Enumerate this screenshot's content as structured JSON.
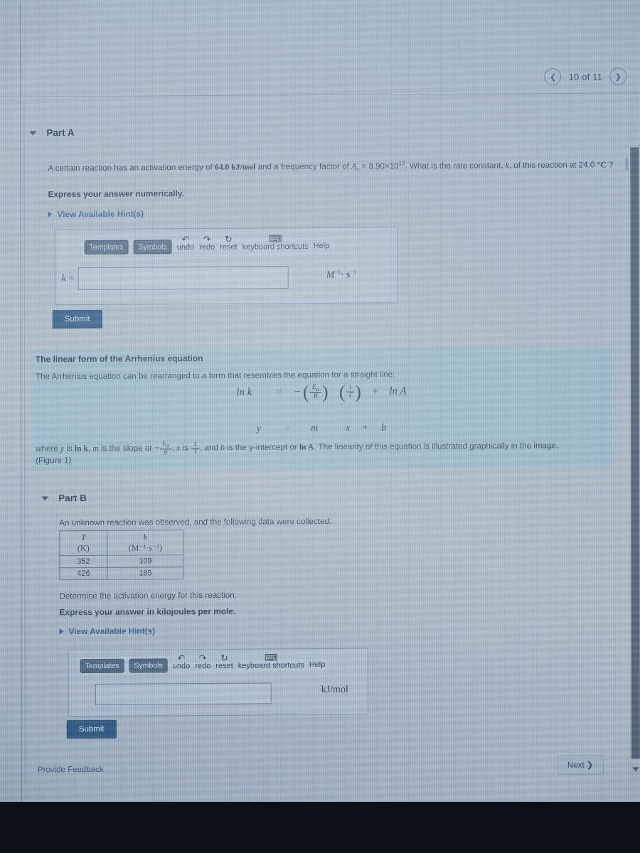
{
  "pager": {
    "prev_icon": "chevron-left-icon",
    "label": "10 of 11",
    "next_icon": "chevron-right-icon"
  },
  "partA": {
    "title": "Part A",
    "question_line1_pre": "A certain reaction has an activation energy of ",
    "activation_energy": "64.0",
    "energy_units": "kJ/mol",
    "question_line1_mid": " and a frequency factor of ",
    "frequency_symbol": "A",
    "frequency_subscript": "1",
    "frequency_value": "8.90×10",
    "frequency_exponent": "12",
    "question_line1_post": ". What is the rate constant, ",
    "rate_symbol": "k",
    "question_line1_end": ", of this reaction at ",
    "temperature": "24.0",
    "temperature_units": "°C",
    "question_mark": "?",
    "instruction": "Express your answer numerically.",
    "hint_label": "View Available Hint(s)",
    "answer_prefix": "k =",
    "answer_value": "",
    "answer_units_num": "M",
    "answer_units_sup1": "−1",
    "answer_units_sup2": "−1",
    "answer_units_mid": "· s",
    "submit_label": "Submit"
  },
  "toolbar": {
    "templates_label": "Templates",
    "symbols_label": "Symbols",
    "undo_label": "undo",
    "undo_icon": "undo-arrow-icon",
    "redo_label": "redo",
    "redo_icon": "redo-arrow-icon",
    "reset_label": "reset",
    "reset_icon": "reset-icon",
    "shortcuts_label": "keyboard shortcuts",
    "shortcuts_icon": "keyboard-icon",
    "help_label": "Help",
    "help_icon": "help-icon"
  },
  "info_panel": {
    "title": "The linear form of the Arrhenius equation",
    "intro": "The Arrhenius equation can be rearranged to a form that resembles the equation for a straight line:",
    "equation": {
      "lhs": "ln k",
      "equals": "=",
      "minus": "−",
      "frac1_num": "E",
      "frac1_sub": "a",
      "frac1_den": "R",
      "frac2_num": "1",
      "frac2_den": "T",
      "plus": "+",
      "rhs": "ln A"
    },
    "template_row": {
      "y": "y",
      "equals": "=",
      "m": "m",
      "x": "x",
      "plus": "+",
      "b": "b"
    },
    "where_pre": "where ",
    "where_y": "y",
    "where_1": " is ",
    "where_lnk": "ln k",
    "where_2": ", ",
    "where_m": "m",
    "where_3": " is the slope or ",
    "where_slope_num": "E",
    "where_slope_sub": "a",
    "where_slope_den": "R",
    "where_4": ", ",
    "where_x": "x",
    "where_5": " is ",
    "where_x_num": "1",
    "where_x_den": "T",
    "where_6": ", and ",
    "where_b": "b",
    "where_7": " is the y-intercept or ",
    "where_lnA": "ln A",
    "where_8": ". The linearity of this equation is illustrated graphically in the image.",
    "figure_ref": "(Figure 1)"
  },
  "partB": {
    "title": "Part B",
    "intro": "An unknown reaction was observed, and the following data were collected:",
    "table": {
      "headers": [
        {
          "symbol": "T",
          "units": "(K)"
        },
        {
          "symbol": "k",
          "units": "(M⁻¹·s⁻¹)"
        }
      ],
      "rows": [
        {
          "T": "352",
          "k": "109"
        },
        {
          "T": "426",
          "k": "185"
        }
      ]
    },
    "question": "Determine the activation energy for this reaction.",
    "instruction": "Express your answer in kilojoules per mole.",
    "hint_label": "View Available Hint(s)",
    "answer_value": "",
    "answer_units": "kJ/mol",
    "submit_label": "Submit"
  },
  "footer": {
    "feedback_label": "Provide Feedback",
    "next_label": "Next",
    "next_icon": "chevron-right-icon"
  },
  "chart_data": {
    "type": "table",
    "title": "Rate constant vs temperature",
    "columns": [
      "T (K)",
      "k (M⁻¹·s⁻¹)"
    ],
    "x": [
      352,
      426
    ],
    "values": [
      109,
      185
    ],
    "xlabel": "T (K)",
    "ylabel": "k (M⁻¹·s⁻¹)"
  },
  "colors": {
    "page_bg": "#b9c3cd",
    "info_panel": "#92c4ce",
    "submit_blue": "#1d4f80",
    "link_blue": "#1f5b93",
    "text": "#1b2e45"
  }
}
